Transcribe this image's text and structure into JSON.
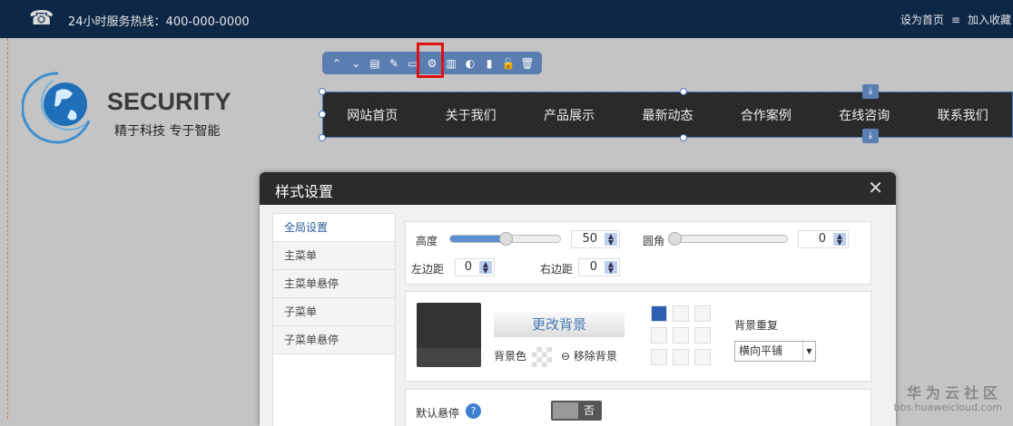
{
  "topbar": {
    "hotline": "24小时服务热线：400-000-0000",
    "set_home": "设为首页",
    "sep": "≡",
    "add_fav": "加入收藏"
  },
  "logo": {
    "brand": "SECURITY",
    "slogan": "精于科技  专于智能"
  },
  "nav": {
    "items": [
      "网站首页",
      "关于我们",
      "产品展示",
      "最新动态",
      "合作案例",
      "在线咨询",
      "联系我们"
    ]
  },
  "dialog": {
    "title": "样式设置",
    "tabs": [
      "全局设置",
      "主菜单",
      "主菜单悬停",
      "子菜单",
      "子菜单悬停"
    ],
    "height_label": "高度",
    "height_value": "50",
    "height_fraction": 0.5,
    "radius_label": "圆角",
    "radius_value": "0",
    "left_label": "左边距",
    "left_value": "0",
    "right_label": "右边距",
    "right_value": "0",
    "change_bg": "更改背景",
    "bg_color": "背景色",
    "remove_bg": "移除背景",
    "bg_repeat_label": "背景重复",
    "bg_repeat_value": "横向平铺",
    "default_hover": "默认悬停",
    "toggle_value": "否"
  },
  "watermark": {
    "text": "华为云社区",
    "url": "bbs.huaweicloud.com"
  }
}
